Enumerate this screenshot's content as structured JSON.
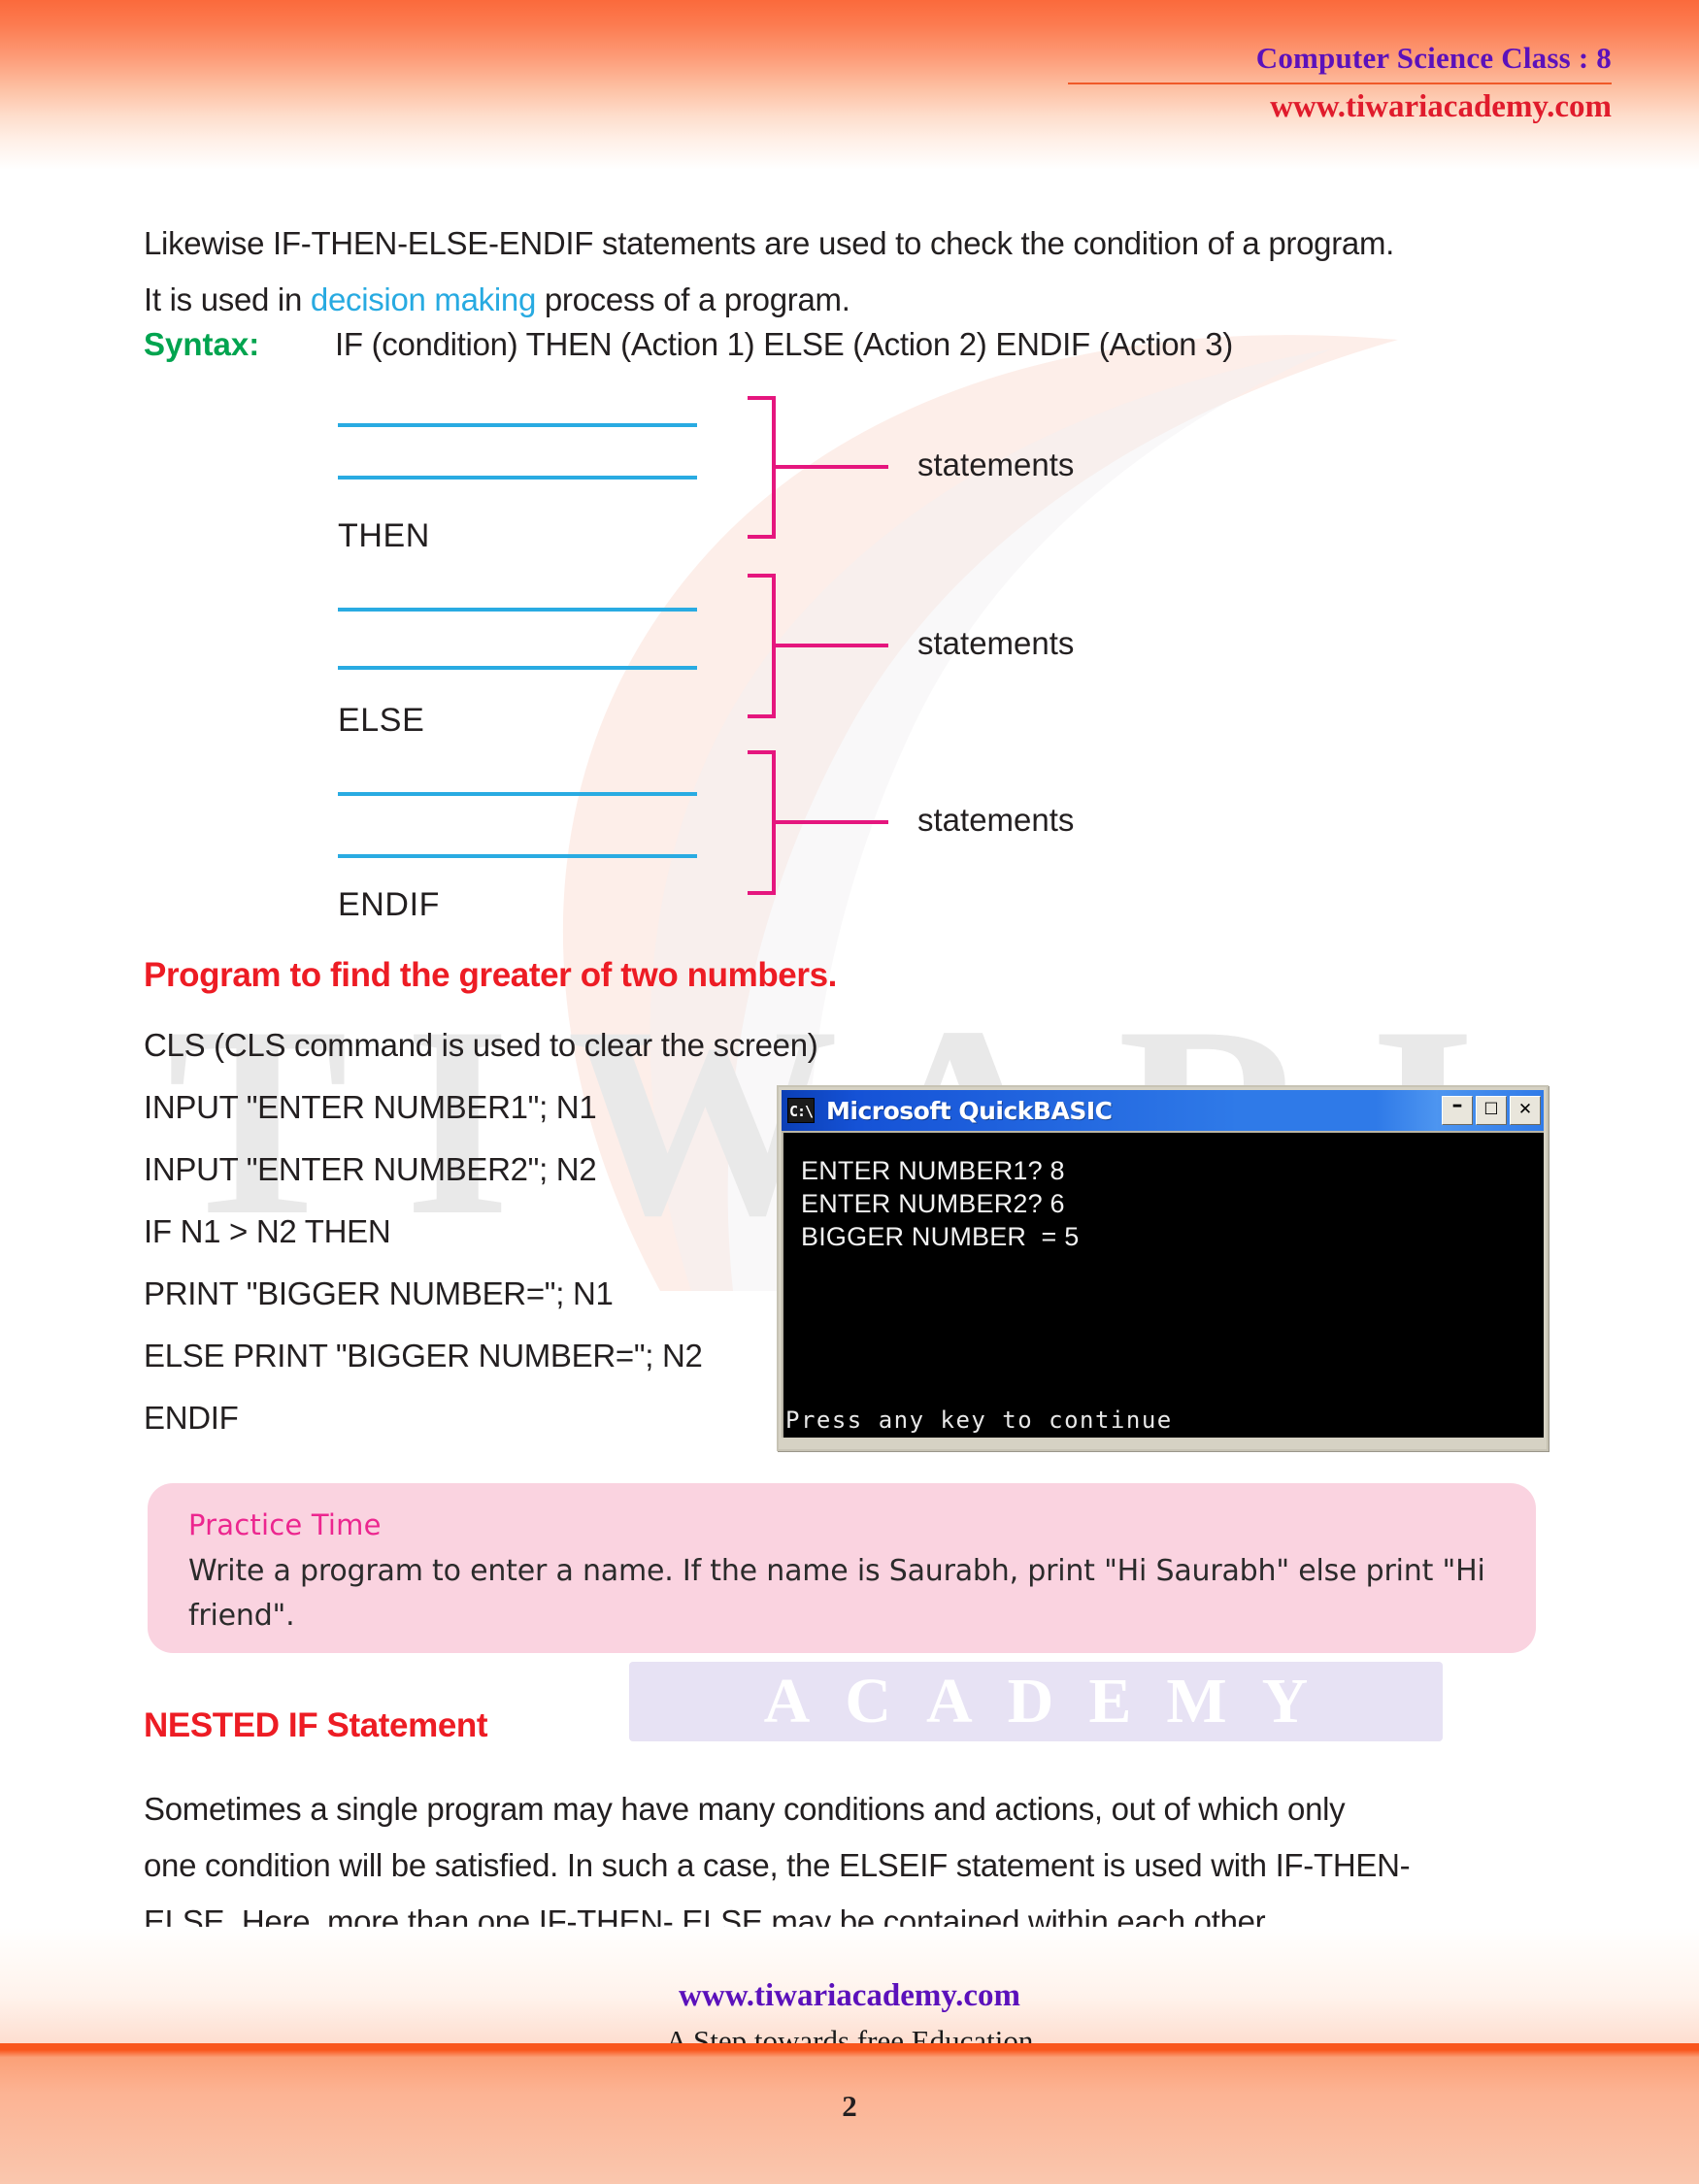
{
  "header": {
    "title": "Computer Science Class : 8",
    "site": "www.tiwariacademy.com"
  },
  "watermark": {
    "brand": "TIWARI",
    "sub": "ACADEMY"
  },
  "intro": {
    "line1_before": "Likewise IF-THEN-ELSE-ENDIF statements are used to check the condition of a program.",
    "line2_before": "It is used in ",
    "line2_highlight": "decision making",
    "line2_after": " process of a program."
  },
  "syntax": {
    "label": "Syntax:",
    "text": "IF (condition) THEN (Action 1) ELSE (Action 2) ENDIF (Action 3)"
  },
  "diagram": {
    "keywords": [
      "THEN",
      "ELSE",
      "ENDIF"
    ],
    "statement_labels": [
      "statements",
      "statements",
      "statements"
    ],
    "rule_color": "#29abe2",
    "bracket_color": "#e5167e"
  },
  "program": {
    "heading": "Program to find the greater of two numbers.",
    "lines": [
      "CLS  (CLS command is used to clear the screen)",
      "INPUT \"ENTER NUMBER1\"; N1",
      "INPUT \"ENTER NUMBER2\"; N2",
      "IF N1 > N2 THEN",
      "PRINT \"BIGGER NUMBER=\"; N1",
      "ELSE PRINT \"BIGGER NUMBER=\"; N2",
      "ENDIF"
    ]
  },
  "qb_window": {
    "icon_label": "C:\\",
    "title": "Microsoft QuickBASIC",
    "minimize": "–",
    "maximize": "☐",
    "close": "✕",
    "output": "ENTER NUMBER1? 8\nENTER NUMBER2? 6\nBIGGER NUMBER  = 5",
    "prompt": "Press any key to continue"
  },
  "practice": {
    "title": "Practice Time",
    "body": "Write a program to enter a name. If the name is Saurabh, print \"Hi Saurabh\" else print \"Hi friend\"."
  },
  "nested": {
    "heading": "NESTED IF Statement",
    "line1": "Sometimes a single program may have many conditions and actions, out of which only",
    "line2": "one condition will be satisfied. In such a case, the ELSEIF statement is used with IF-THEN-",
    "line3": "ELSE. Here, more than one IF-THEN- ELSE may be contained within each other."
  },
  "footer": {
    "site": "www.tiwariacademy.com",
    "tagline": "A Step towards free Education",
    "page_number": "2"
  }
}
